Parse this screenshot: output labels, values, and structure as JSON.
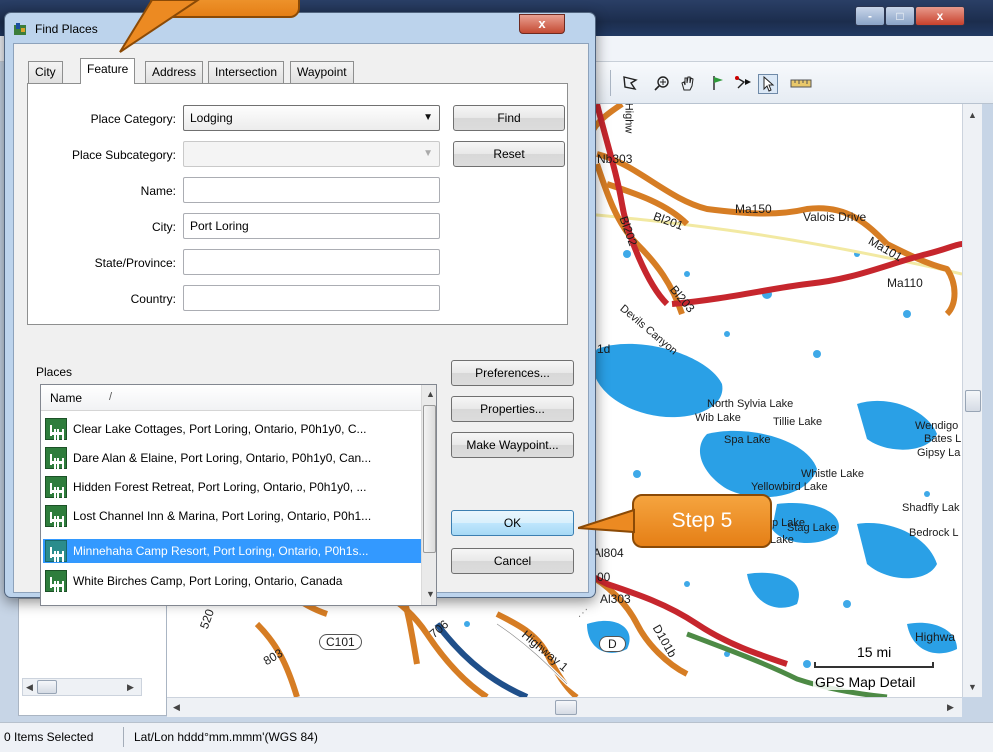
{
  "dialog": {
    "title": "Find Places",
    "close_label": "x",
    "tabs": [
      "City",
      "Feature",
      "Address",
      "Intersection",
      "Waypoint"
    ],
    "active_tab": "Feature",
    "form": {
      "place_category_label": "Place Category:",
      "place_category_value": "Lodging",
      "place_subcategory_label": "Place Subcategory:",
      "place_subcategory_value": "",
      "name_label": "Name:",
      "name_value": "",
      "city_label": "City:",
      "city_value": "Port Loring",
      "state_label": "State/Province:",
      "state_value": "",
      "country_label": "Country:",
      "country_value": ""
    },
    "buttons": {
      "find": "Find",
      "reset": "Reset",
      "preferences": "Preferences...",
      "properties": "Properties...",
      "make_waypoint": "Make Waypoint...",
      "ok": "OK",
      "cancel": "Cancel"
    },
    "places": {
      "label": "Places",
      "column_header": "Name",
      "sort_indicator": "/",
      "rows": [
        "Clear Lake Cottages, Port Loring, Ontario, P0h1y0, C...",
        "Dare Alan & Elaine, Port Loring, Ontario, P0h1y0, Can...",
        "Hidden Forest Retreat, Port Loring, Ontario, P0h1y0, ...",
        "Lost Channel Inn & Marina, Port Loring, Ontario, P0h1...",
        "Minnehaha Camp Resort, Port Loring, Ontario, P0h1s...",
        "White Birches Camp, Port Loring, Ontario, Canada"
      ],
      "selected_row": "Minnehaha Camp Resort, Port Loring, Ontario, P0h1s..."
    }
  },
  "callouts": {
    "step5": "Step 5"
  },
  "app": {
    "window_buttons": [
      "-",
      "□",
      "x"
    ]
  },
  "map": {
    "labels": {
      "nb303": "Nb303",
      "ma150": "Ma150",
      "valois": "Valois Drive",
      "ma101": "Ma101",
      "ma110": "Ma110",
      "bl201": "Bl201",
      "bl202": "Bl202",
      "bl203": "Bl203",
      "devils_canyon": "Devils Canyon",
      "highway_top": "Highw",
      "north_sylvia": "North Sylvia Lake",
      "wib": "Wib Lake",
      "tillie": "Tillie Lake",
      "spa": "Spa Lake",
      "wendigo": "Wendigo",
      "bates": "Bates L",
      "gipsy": "Gipsy La",
      "whistle": "Whistle Lake",
      "yellowbird": "Yellowbird Lake",
      "p_lake": "p Lake",
      "stag": "Stag Lake",
      "shadfly": "Shadfly Lak",
      "bedrock": "Bedrock L",
      "lake": "Lake",
      "c101": "C101",
      "d": "D",
      "highway_br": "Highwa",
      "al804": "Al804",
      "al303": "Al303",
      "d101b": "D101b",
      "highway_mid": "Highway 1",
      "b03": "803",
      "n706": "706",
      "r520": "520",
      "oo": "00",
      "n1d": "1d"
    },
    "scale_label": "15 mi",
    "detail_label": "GPS Map Detail"
  },
  "status": {
    "selected": "0 Items Selected",
    "coords": "Lat/Lon hddd°mm.mmm'(WGS 84)"
  }
}
